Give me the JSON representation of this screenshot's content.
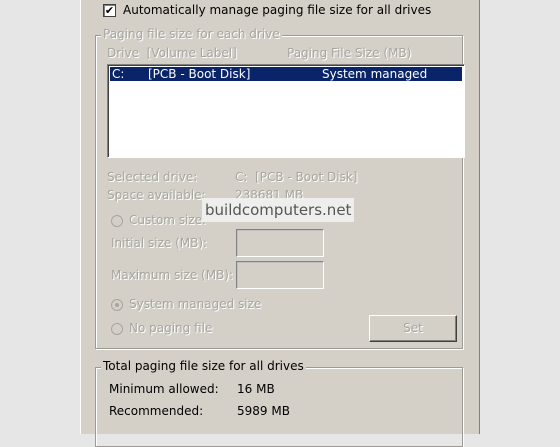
{
  "auto_manage": {
    "label": "Automatically manage paging file size for all drives",
    "checked": true,
    "check_glyph": "✔"
  },
  "per_drive": {
    "legend": "Paging file size for each drive",
    "col_drive": "Drive  [Volume Label]",
    "col_size": "Paging File Size (MB)",
    "rows": [
      {
        "drive": "C:",
        "label": "[PCB - Boot Disk]",
        "size": "System managed"
      }
    ],
    "selected_drive_label": "Selected drive:",
    "selected_drive_value": "C:  [PCB - Boot Disk]",
    "space_label": "Space available:",
    "space_value": "238681 MB",
    "custom_size_label": "Custom size:",
    "initial_size_label": "Initial size (MB):",
    "initial_size_value": "",
    "max_size_label": "Maximum size (MB):",
    "max_size_value": "",
    "system_managed_label": "System managed size",
    "no_paging_label": "No paging file",
    "set_button": "Set"
  },
  "total": {
    "legend": "Total paging file size for all drives",
    "min_label": "Minimum allowed:",
    "min_value": "16 MB",
    "recommended_label": "Recommended:",
    "recommended_value": "5989 MB"
  },
  "watermark": "buildcomputers.net",
  "colors": {
    "dialog_bg": "#d4d0c8",
    "selection": "#0a246a",
    "disabled_text": "#a7a59f"
  }
}
